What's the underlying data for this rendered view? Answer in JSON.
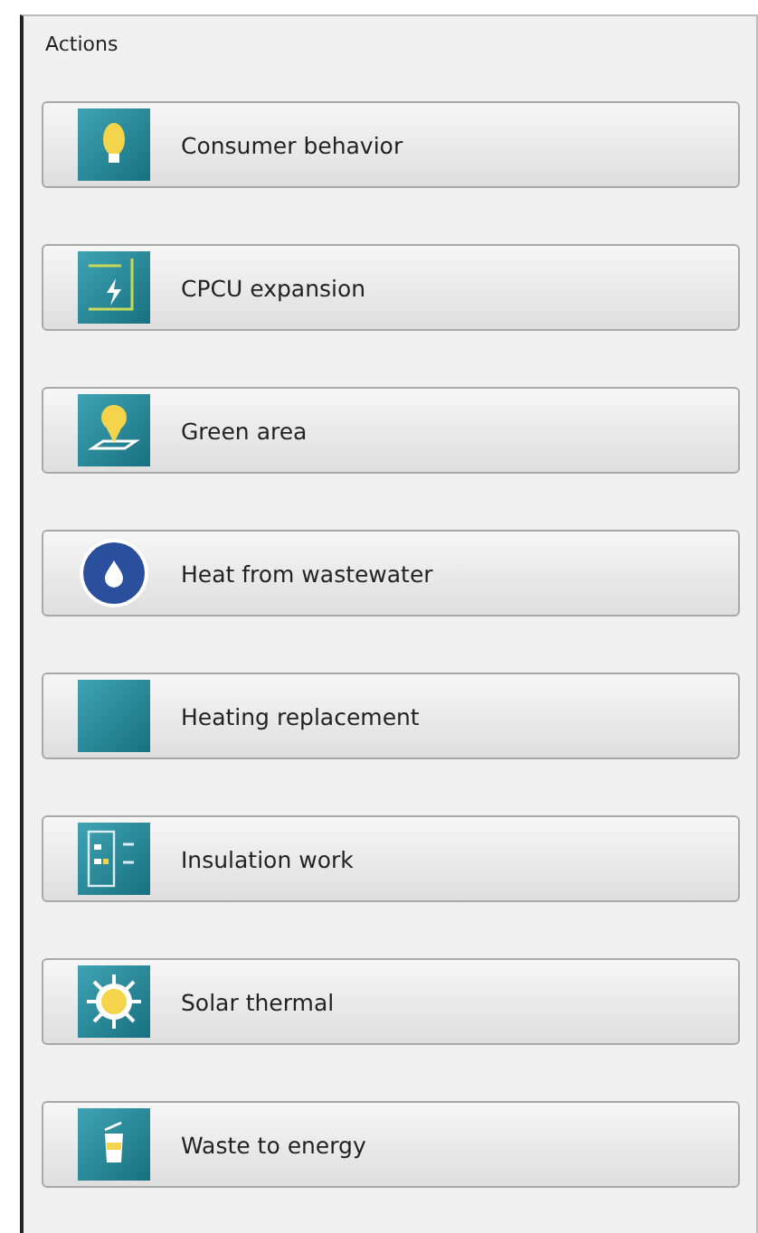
{
  "group": {
    "title": "Actions"
  },
  "buttons": [
    {
      "label": "Consumer behavior"
    },
    {
      "label": "CPCU expansion"
    },
    {
      "label": "Green area"
    },
    {
      "label": "Heat from wastewater"
    },
    {
      "label": "Heating replacement"
    },
    {
      "label": "Insulation work"
    },
    {
      "label": "Solar thermal"
    },
    {
      "label": "Waste to energy"
    }
  ]
}
